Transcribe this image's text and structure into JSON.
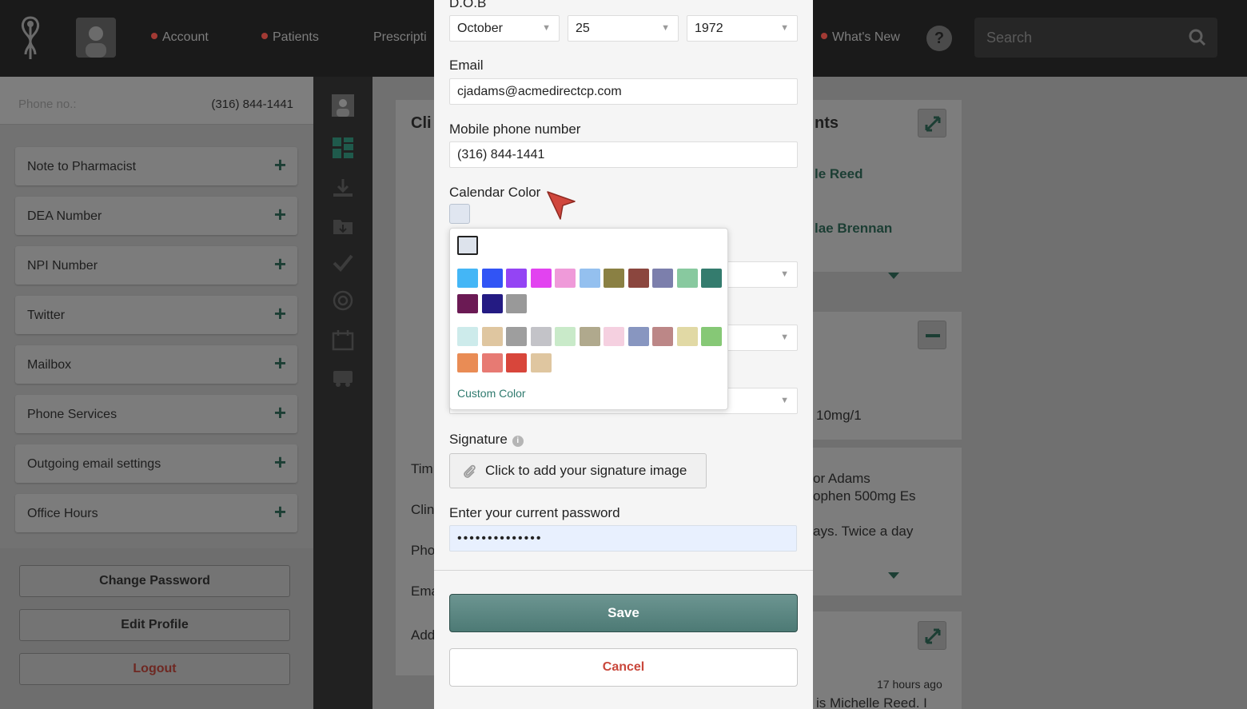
{
  "topbar": {
    "nav": [
      "Account",
      "Patients",
      "Prescripti",
      "What's New"
    ],
    "help": "?",
    "search_placeholder": "Search"
  },
  "sidebar": {
    "phone_label": "Phone no.:",
    "phone_value": "(316) 844-1441",
    "items": [
      "Note to Pharmacist",
      "DEA Number",
      "NPI Number",
      "Twitter",
      "Mailbox",
      "Phone Services",
      "Outgoing email settings",
      "Office Hours"
    ],
    "plus": "+",
    "buttons": {
      "change_password": "Change Password",
      "edit_profile": "Edit Profile",
      "logout": "Logout"
    }
  },
  "background_panels": {
    "left_heading": "Cli",
    "left_rows": [
      "Tim",
      "Clin",
      "Pho",
      "Ema",
      "Add"
    ],
    "right_heading": "nts",
    "right_names": [
      "le Reed",
      "lae Brennan"
    ],
    "dose": "10mg/1",
    "lines": [
      "or Adams",
      "ophen 500mg Es",
      "ays. Twice a day"
    ],
    "time_ago": "17 hours ago",
    "last_line": "is Michelle Reed. I"
  },
  "modal": {
    "dob_label": "D.O.B",
    "dob_month": "October",
    "dob_day": "25",
    "dob_year": "1972",
    "arrow_glyph": "▼",
    "email_label": "Email",
    "email_value": "cjadams@acmedirectcp.com",
    "mobile_label": "Mobile phone number",
    "mobile_value": "(316) 844-1441",
    "calendar_color_label": "Calendar Color",
    "signature_label": "Signature",
    "info_glyph": "i",
    "signature_button": "Click to add your signature image",
    "password_label": "Enter your current password",
    "password_value": "••••••••••••••",
    "save": "Save",
    "cancel": "Cancel"
  },
  "color_picker": {
    "selected_color": "#dde3ec",
    "row1": [
      "#44b6f6",
      "#3154f5",
      "#9444f4",
      "#e243f0",
      "#ef9ad9",
      "#94c0ef",
      "#8a8043",
      "#8b463e",
      "#7c7fac",
      "#88c99f",
      "#347c6e"
    ],
    "row2": [
      "#6b1a54",
      "#241b83",
      "#999999"
    ],
    "row3": [
      "#cdebeb",
      "#dfc6a0",
      "#9e9e9e",
      "#c3c3c8",
      "#c9eac9",
      "#b0a98d",
      "#f5d0e0",
      "#8896c0",
      "#bc8787",
      "#e1d9a5",
      "#86c876"
    ],
    "row4": [
      "#e98c55",
      "#e77a73",
      "#d8463b",
      "#dfc6a0"
    ],
    "custom_color": "Custom Color"
  },
  "colors": {
    "accent_teal": "#4d7a75",
    "cancel_red": "#c9473b",
    "link_teal": "#2f7a6e",
    "cursor_red": "#d0473d"
  }
}
